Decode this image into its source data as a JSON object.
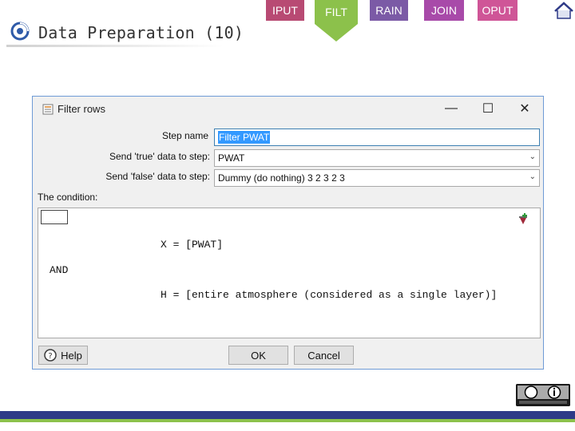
{
  "nav": {
    "tabs": [
      "IPUT",
      "FILT",
      "RAIN",
      "JOIN",
      "OPUT"
    ]
  },
  "slide": {
    "title": "Data Preparation (10)"
  },
  "dialog": {
    "title": "Filter rows",
    "step_name_label": "Step name",
    "step_name_value": "Filter PWAT",
    "true_label": "Send 'true' data to step:",
    "true_value": "PWAT",
    "false_label": "Send 'false' data to step:",
    "false_value": "Dummy (do nothing) 3 2 3 2 3",
    "condition_label": "The condition:",
    "condition": {
      "line1": "X = [PWAT]",
      "operator": "AND",
      "line2": "H = [entire atmosphere (considered as a single layer)]"
    },
    "buttons": {
      "help": "Help",
      "ok": "OK",
      "cancel": "Cancel"
    }
  },
  "colors": {
    "iput": "#b84a73",
    "filt": "#8cc14b",
    "rain": "#7b5aa6",
    "join": "#a84aa9",
    "oput": "#cf5597",
    "footer": "#2e3a87"
  }
}
